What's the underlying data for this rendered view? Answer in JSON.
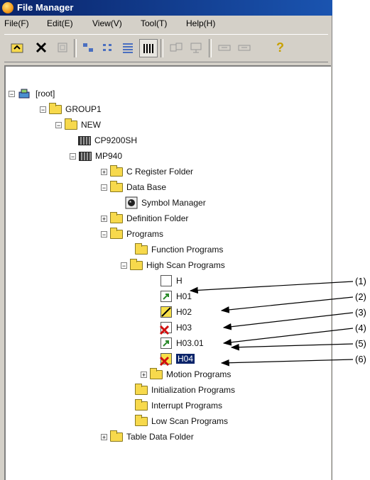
{
  "window": {
    "title": "File Manager"
  },
  "menu": [
    "File(F)",
    "Edit(E)",
    "View(V)",
    "Tool(T)",
    "Help(H)"
  ],
  "tree": {
    "root": "[root]",
    "group": "GROUP1",
    "new": "NEW",
    "cp": "CP9200SH",
    "mp": "MP940",
    "c_register": "C Register Folder",
    "database": "Data Base",
    "symbol_manager": "Symbol Manager",
    "definition": "Definition Folder",
    "programs": "Programs",
    "function_programs": "Function Programs",
    "high_scan": "High Scan Programs",
    "h": "H",
    "h01": "H01",
    "h02": "H02",
    "h03": "H03",
    "h0301": "H03.01",
    "h04": "H04",
    "motion": "Motion Programs",
    "init": "Initialization Programs",
    "interrupt": "Interrupt Programs",
    "low_scan": "Low Scan Programs",
    "table_data": "Table Data Folder"
  },
  "annotations": [
    "(1)",
    "(2)",
    "(3)",
    "(4)",
    "(5)",
    "(6)"
  ]
}
